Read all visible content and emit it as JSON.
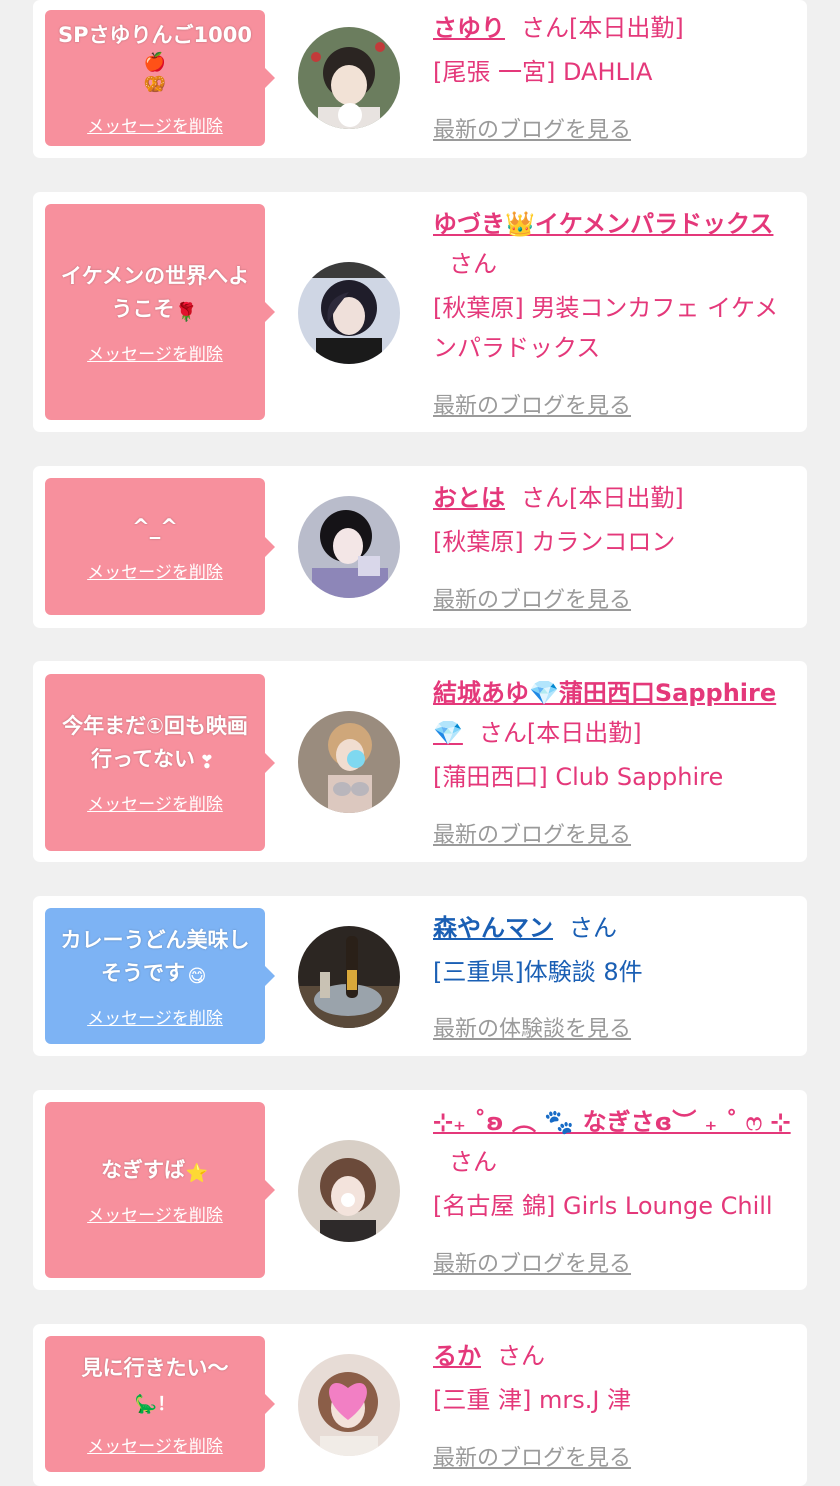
{
  "colors": {
    "pink_bubble": "#f7909d",
    "blue_bubble": "#7db3f4",
    "pink_text": "#e4387a",
    "blue_text": "#1a5fb4",
    "link_gray": "#9a9a9a",
    "page_bg": "#f0f0f0"
  },
  "delete_label": "メッセージを削除",
  "items": [
    {
      "message": "SPさゆりんご1000",
      "message_emoji": "🍎🥨",
      "name": "さゆり",
      "suffix": "さん[本日出勤]",
      "shop": "[尾張 一宮] DAHLIA",
      "link": "最新のブログを見る",
      "theme": "pink",
      "avatar_icon": "photo-avatar"
    },
    {
      "message": "イケメンの世界へようこそ",
      "message_emoji": "🌹",
      "name": "ゆづき👑イケメンパラドックス",
      "suffix": "さん",
      "shop": "[秋葉原] 男装コンカフェ イケメンパラドックス",
      "link": "最新のブログを見る",
      "theme": "pink",
      "avatar_icon": "photo-avatar"
    },
    {
      "message": "^_^",
      "message_emoji": "",
      "name": "おとは",
      "suffix": "さん[本日出勤]",
      "shop": "[秋葉原] カランコロン",
      "link": "最新のブログを見る",
      "theme": "pink",
      "avatar_icon": "photo-avatar"
    },
    {
      "message": "今年まだ①回も映画行ってない",
      "message_emoji": "❣",
      "name": "結城あゆ💎蒲田西口Sapphire💎",
      "suffix": "さん[本日出勤]",
      "shop": "[蒲田西口] Club Sapphire",
      "link": "最新のブログを見る",
      "theme": "pink",
      "avatar_icon": "photo-avatar"
    },
    {
      "message": "カレーうどん美味しそうです",
      "message_emoji": "😋",
      "name": "森やんマン",
      "suffix": "さん",
      "shop": "[三重県]体験談 8件",
      "link": "最新の体験談を見る",
      "theme": "blue",
      "avatar_icon": "photo-avatar"
    },
    {
      "message": "なぎすば",
      "message_emoji": "⭐",
      "name": "⊹₊ ˚ʚ︎ ︵ 🐾 なぎさɞ︎︶ ₊ ˚ ෆ ⊹",
      "suffix": "さん",
      "shop": "[名古屋 錦] Girls Lounge Chill",
      "link": "最新のブログを見る",
      "theme": "pink",
      "avatar_icon": "photo-avatar"
    },
    {
      "message": "見に行きたい〜",
      "message_emoji": "🦕！",
      "name": "るか",
      "suffix": "さん",
      "shop": "[三重 津] mrs.J 津",
      "link": "最新のブログを見る",
      "theme": "pink",
      "avatar_icon": "photo-avatar"
    }
  ]
}
